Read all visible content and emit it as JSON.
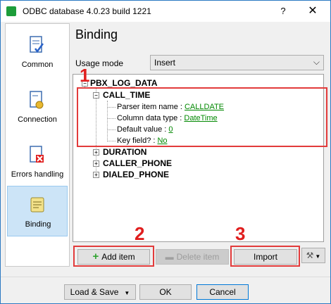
{
  "window": {
    "title": "ODBC database 4.0.23 build 1221",
    "help_label": "?",
    "close_label": "✕"
  },
  "nav": {
    "items": [
      {
        "label": "Common"
      },
      {
        "label": "Connection"
      },
      {
        "label": "Errors handling"
      },
      {
        "label": "Binding"
      }
    ],
    "active": "Binding"
  },
  "main": {
    "heading": "Binding",
    "usage_mode_label": "Usage mode",
    "usage_mode_value": "Insert"
  },
  "tree": {
    "root": "PBX_LOG_DATA",
    "items": [
      {
        "name": "CALL_TIME",
        "expanded": true,
        "props": [
          {
            "label": "Parser item name : ",
            "value": "CALLDATE"
          },
          {
            "label": "Column data type : ",
            "value": "DateTime"
          },
          {
            "label": "Default value : ",
            "value": "0"
          },
          {
            "label": "Key field? : ",
            "value": "No"
          }
        ]
      },
      {
        "name": "DURATION"
      },
      {
        "name": "CALLER_PHONE"
      },
      {
        "name": "DIALED_PHONE"
      }
    ]
  },
  "actions": {
    "add_item": "Add item",
    "delete_item": "Delete item",
    "import": "Import"
  },
  "footer": {
    "load_save": "Load & Save",
    "ok": "OK",
    "cancel": "Cancel"
  },
  "callouts": [
    "1",
    "2",
    "3"
  ],
  "colors": {
    "highlight": "#e23b3b",
    "link": "#008800",
    "add_icon": "#2fa32f"
  }
}
